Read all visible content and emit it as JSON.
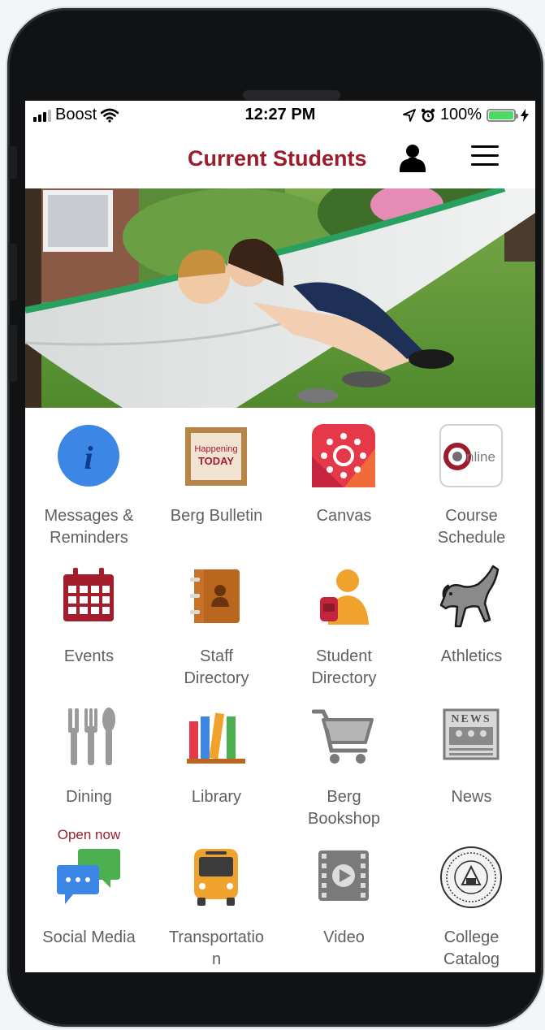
{
  "status_bar": {
    "carrier": "Boost",
    "time": "12:27 PM",
    "battery": "100%",
    "signal_icon": "signal-bars-icon",
    "wifi_icon": "wifi-icon",
    "location_icon": "location-arrow-icon",
    "alarm_icon": "alarm-clock-icon",
    "battery_icon": "battery-icon",
    "charging_icon": "charging-bolt-icon"
  },
  "header": {
    "title": "Current Students",
    "profile_icon": "user-icon",
    "menu_icon": "hamburger-menu-icon"
  },
  "colors": {
    "brand": "#9b1c2c",
    "label": "#606060",
    "battery_green": "#4cd964",
    "info_blue": "#3c86e5"
  },
  "tiles": [
    {
      "label1": "Messages &",
      "label2": "Reminders",
      "icon": "info-icon"
    },
    {
      "label1": "Berg Bulletin",
      "label2": "",
      "icon": "bulletin-board-icon",
      "icon_text1": "Happening",
      "icon_text2": "TODAY"
    },
    {
      "label1": "Canvas",
      "label2": "",
      "icon": "canvas-icon"
    },
    {
      "label1": "Course",
      "label2": "Schedule",
      "icon": "online-course-icon",
      "icon_text": "nline"
    },
    {
      "label1": "Events",
      "label2": "",
      "icon": "calendar-icon"
    },
    {
      "label1": "Staff",
      "label2": "Directory",
      "icon": "address-book-icon"
    },
    {
      "label1": "Student",
      "label2": "Directory",
      "icon": "student-backpack-icon"
    },
    {
      "label1": "Athletics",
      "label2": "",
      "icon": "bucking-horse-mascot-icon"
    },
    {
      "label1": "Dining",
      "label2": "",
      "icon": "utensils-icon",
      "status": "Open now"
    },
    {
      "label1": "Library",
      "label2": "",
      "icon": "books-icon"
    },
    {
      "label1": "Berg",
      "label2": "Bookshop",
      "icon": "shopping-cart-icon"
    },
    {
      "label1": "News",
      "label2": "",
      "icon": "newspaper-icon",
      "icon_text": "NEWS"
    },
    {
      "label1": "Social Media",
      "label2": "",
      "icon": "chat-bubbles-icon"
    },
    {
      "label1": "Transportatio",
      "label2": "n",
      "icon": "bus-icon"
    },
    {
      "label1": "Video",
      "label2": "",
      "icon": "video-film-icon"
    },
    {
      "label1": "College",
      "label2": "Catalog",
      "icon": "college-seal-icon"
    }
  ]
}
